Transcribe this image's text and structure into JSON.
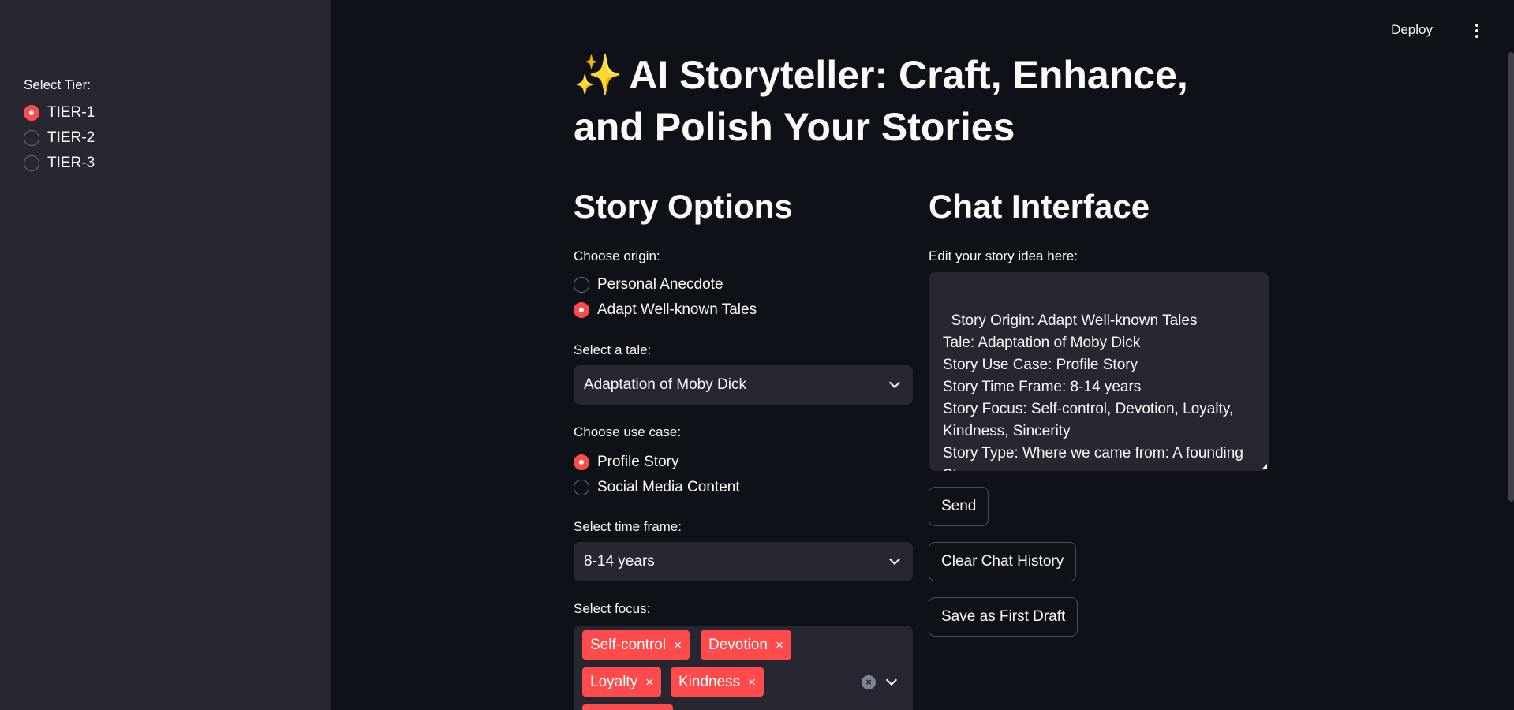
{
  "sidebar": {
    "label": "Select Tier:",
    "options": [
      {
        "label": "TIER-1",
        "checked": true
      },
      {
        "label": "TIER-2",
        "checked": false
      },
      {
        "label": "TIER-3",
        "checked": false
      }
    ]
  },
  "header": {
    "deploy_label": "Deploy",
    "menu_icon": "kebab-menu-icon"
  },
  "title": {
    "icon": "✨",
    "text": "AI Storyteller: Craft, Enhance, and Polish Your Stories"
  },
  "story_options": {
    "heading": "Story Options",
    "origin": {
      "label": "Choose origin:",
      "options": [
        {
          "label": "Personal Anecdote",
          "checked": false
        },
        {
          "label": "Adapt Well-known Tales",
          "checked": true
        }
      ]
    },
    "tale": {
      "label": "Select a tale:",
      "value": "Adaptation of Moby Dick"
    },
    "use_case": {
      "label": "Choose use case:",
      "options": [
        {
          "label": "Profile Story",
          "checked": true
        },
        {
          "label": "Social Media Content",
          "checked": false
        }
      ]
    },
    "time_frame": {
      "label": "Select time frame:",
      "value": "8-14 years"
    },
    "focus": {
      "label": "Select focus:",
      "tags": [
        "Self-control",
        "Devotion",
        "Loyalty",
        "Kindness"
      ],
      "remove_glyph": "×"
    }
  },
  "chat": {
    "heading": "Chat Interface",
    "textarea_label": "Edit your story idea here:",
    "textarea_value": "Story Origin: Adapt Well-known Tales\nTale: Adaptation of Moby Dick\nStory Use Case: Profile Story\nStory Time Frame: 8-14 years\nStory Focus: Self-control, Devotion, Loyalty,\nKindness, Sincerity\nStory Type: Where we came from: A founding\nStory",
    "send_label": "Send",
    "clear_label": "Clear Chat History",
    "save_label": "Save as First Draft"
  },
  "colors": {
    "accent": "#ff4b4b",
    "background": "#0e1117",
    "sidebar": "#262730"
  }
}
